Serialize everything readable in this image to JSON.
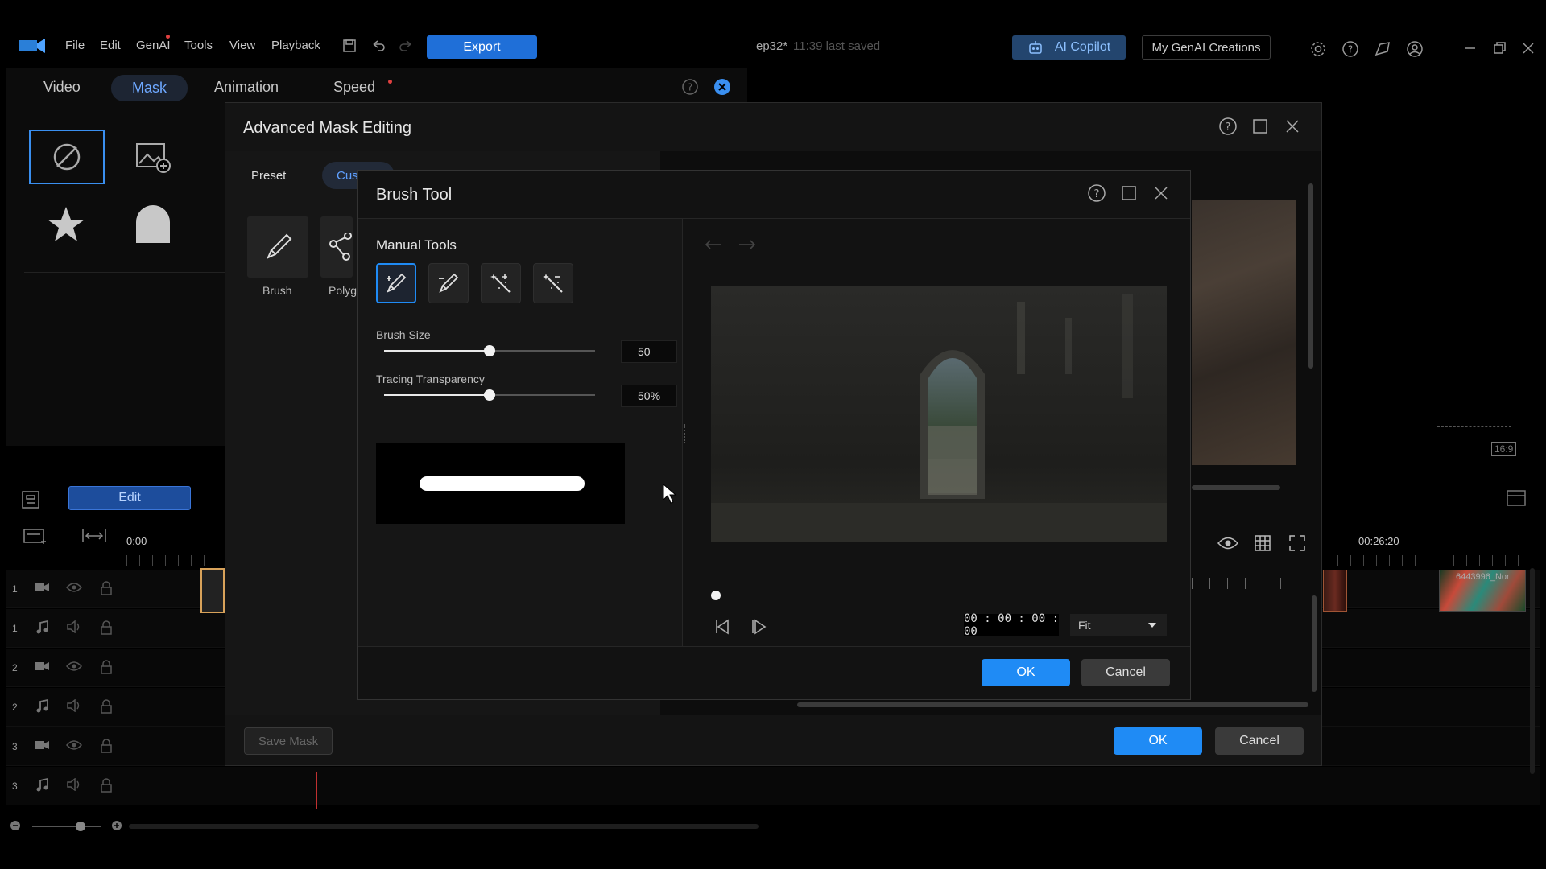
{
  "app": {
    "menu": [
      "File",
      "Edit",
      "GenAI",
      "Tools",
      "View",
      "Playback"
    ],
    "export_label": "Export",
    "project_title": "ep32*",
    "save_status": "11:39 last saved",
    "ai_copilot_label": "AI Copilot",
    "genai_creations_label": "My GenAI Creations"
  },
  "panel": {
    "tabs": [
      "Video",
      "Mask",
      "Animation",
      "Speed"
    ],
    "active_tab": "Mask",
    "edit_label": "Edit"
  },
  "timeline": {
    "time_start": "0:00",
    "time_right": "00:26:20",
    "clip_right_label": "6443996_Nor",
    "tracks": [
      "1",
      "1",
      "2",
      "2",
      "3",
      "3"
    ]
  },
  "advanced_mask": {
    "title": "Advanced Mask Editing",
    "tabs": [
      "Preset",
      "Cus"
    ],
    "tools": [
      "Brush",
      "Polyg"
    ],
    "save_mask_label": "Save Mask",
    "ok_label": "OK",
    "cancel_label": "Cancel"
  },
  "brush_tool": {
    "title": "Brush Tool",
    "section_title": "Manual Tools",
    "brush_size_label": "Brush Size",
    "brush_size_value": "50",
    "brush_size_fraction": 0.5,
    "transparency_label": "Tracing Transparency",
    "transparency_value": "50%",
    "transparency_fraction": 0.5,
    "timecode": "00 : 00 : 00 : 00",
    "zoom_select": "Fit",
    "ok_label": "OK",
    "cancel_label": "Cancel"
  },
  "colors": {
    "accent": "#1f8bf5",
    "clip_orange": "#e0724f",
    "background": "#000000"
  }
}
